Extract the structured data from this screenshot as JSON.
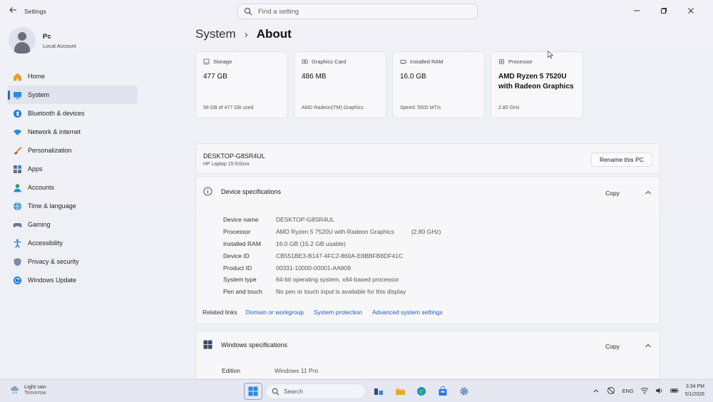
{
  "window": {
    "app_title": "Settings",
    "search_placeholder": "Find a setting"
  },
  "profile": {
    "name": "Pc",
    "account_type": "Local Account"
  },
  "sidebar": {
    "items": [
      {
        "label": "Home",
        "icon": "home-icon"
      },
      {
        "label": "System",
        "icon": "system-icon",
        "active": true
      },
      {
        "label": "Bluetooth & devices",
        "icon": "bluetooth-icon"
      },
      {
        "label": "Network & internet",
        "icon": "wifi-icon"
      },
      {
        "label": "Personalization",
        "icon": "brush-icon"
      },
      {
        "label": "Apps",
        "icon": "apps-icon"
      },
      {
        "label": "Accounts",
        "icon": "person-icon"
      },
      {
        "label": "Time & language",
        "icon": "globe-icon"
      },
      {
        "label": "Gaming",
        "icon": "gamepad-icon"
      },
      {
        "label": "Accessibility",
        "icon": "accessibility-icon"
      },
      {
        "label": "Privacy & security",
        "icon": "shield-icon"
      },
      {
        "label": "Windows Update",
        "icon": "update-icon"
      }
    ]
  },
  "breadcrumb": {
    "parent": "System",
    "separator": "›",
    "current": "About"
  },
  "cards": [
    {
      "title": "Storage",
      "value": "477 GB",
      "detail": "58 GB of 477 GB used",
      "icon": "storage-icon"
    },
    {
      "title": "Graphics Card",
      "value": "486 MB",
      "detail": "AMD Radeon(TM) Graphics",
      "icon": "graphics-card-icon"
    },
    {
      "title": "Installed RAM",
      "value": "16.0 GB",
      "detail": "Speed: 5500 MT/s",
      "icon": "ram-icon"
    },
    {
      "title": "Processor",
      "value": "AMD Ryzen 5 7520U with Radeon Graphics",
      "detail": "2.80 GHz",
      "icon": "processor-icon"
    }
  ],
  "device": {
    "name": "DESKTOP-G8SR4UL",
    "model": "HP Laptop 15-fc0xxx",
    "rename_label": "Rename this PC"
  },
  "device_specs": {
    "title": "Device specifications",
    "copy_label": "Copy",
    "rows": [
      {
        "key": "Device name",
        "value": "DESKTOP-G8SR4UL",
        "extra": ""
      },
      {
        "key": "Processor",
        "value": "AMD Ryzen 5 7520U with Radeon Graphics",
        "extra": "(2.80 GHz)"
      },
      {
        "key": "Installed RAM",
        "value": "16.0 GB (15.2 GB usable)",
        "extra": ""
      },
      {
        "key": "Device ID",
        "value": "CB551BE3-B147-4FC2-860A-E8BBFB8DF41C",
        "extra": ""
      },
      {
        "key": "Product ID",
        "value": "00331-10000-00001-AA809",
        "extra": ""
      },
      {
        "key": "System type",
        "value": "64-bit operating system, x64-based processor",
        "extra": ""
      },
      {
        "key": "Pen and touch",
        "value": "No pen or touch input is available for this display",
        "extra": ""
      }
    ]
  },
  "related_links": {
    "label": "Related links",
    "links": [
      "Domain or workgroup",
      "System protection",
      "Advanced system settings"
    ]
  },
  "windows_specs": {
    "title": "Windows specifications",
    "copy_label": "Copy",
    "rows": [
      {
        "key": "Edition",
        "value": "Windows 11 Pro"
      }
    ]
  },
  "taskbar": {
    "weather_title": "Light rain",
    "weather_sub": "Tomorrow",
    "search_label": "Search",
    "language": "ENG",
    "time": "3:34 PM",
    "date": "5/1/2026"
  },
  "colors": {
    "accent": "#1e6ec8",
    "link": "#1a5fb4",
    "background": "#eef0f6"
  }
}
